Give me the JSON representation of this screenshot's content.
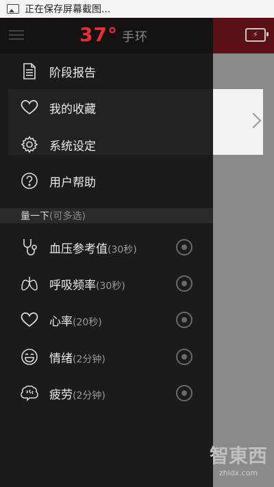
{
  "statusbar": {
    "notification": "正在保存屏幕截图..."
  },
  "app": {
    "brand_mark": "37°",
    "brand_sub": "手环"
  },
  "menu": {
    "items": [
      {
        "label": "阶段报告",
        "icon": "document-icon"
      },
      {
        "label": "我的收藏",
        "icon": "heart-outline-icon"
      },
      {
        "label": "系统设定",
        "icon": "gear-icon"
      },
      {
        "label": "用户帮助",
        "icon": "help-circle-icon"
      }
    ]
  },
  "measure": {
    "header": "量一下",
    "header_note": "(可多选)",
    "items": [
      {
        "label": "血压参考值",
        "note": "(30秒)",
        "icon": "stethoscope-icon"
      },
      {
        "label": "呼吸频率",
        "note": "(30秒)",
        "icon": "lungs-icon"
      },
      {
        "label": "心率",
        "note": "(20秒)",
        "icon": "heart-icon"
      },
      {
        "label": "情绪",
        "note": "(2分钟)",
        "icon": "smiley-icon"
      },
      {
        "label": "疲劳",
        "note": "(2分钟)",
        "icon": "brain-icon"
      }
    ]
  },
  "watermark": {
    "title": "智東西",
    "url": "zhidx.com"
  },
  "colors": {
    "brand": "#e3303a",
    "drawer": "#121212",
    "section": "#2a2a2a"
  }
}
